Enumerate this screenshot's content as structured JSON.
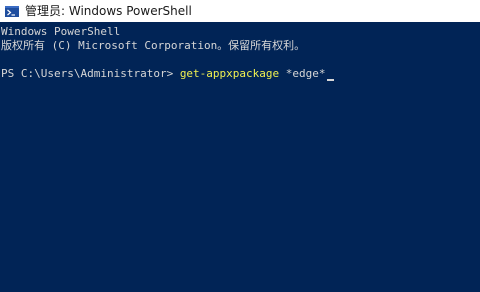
{
  "window": {
    "title": "管理员: Windows PowerShell",
    "icon": "powershell-icon"
  },
  "console": {
    "header_line_1": "Windows PowerShell",
    "header_line_2": "版权所有 (C) Microsoft Corporation。保留所有权利。",
    "prompt": "PS C:\\Users\\Administrator> ",
    "command_name": "get-appxpackage",
    "command_args": " *edge*",
    "colors": {
      "background": "#012456",
      "text": "#d6d6d6",
      "command_highlight": "#f0f050"
    }
  }
}
